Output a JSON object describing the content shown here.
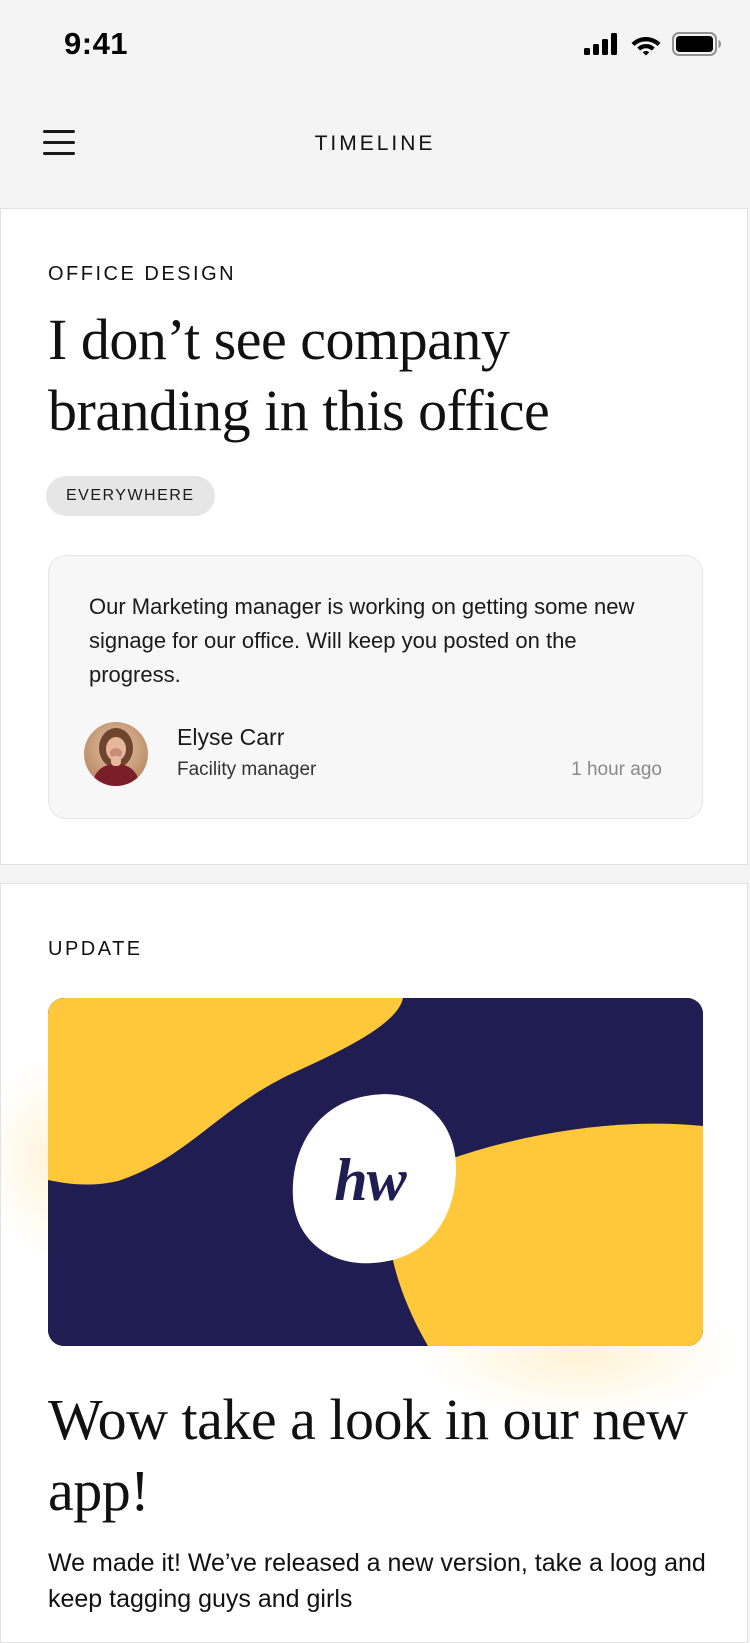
{
  "status_bar": {
    "time": "9:41"
  },
  "nav": {
    "title": "TIMELINE"
  },
  "posts": [
    {
      "category": "OFFICE DESIGN",
      "title": "I don’t see company branding in this office",
      "tag": "EVERYWHERE",
      "comment": {
        "text": "Our Marketing manager is working on getting some new signage for our office. Will keep you posted on the progress.",
        "author_name": "Elyse Carr",
        "author_role": "Facility manager",
        "time": "1 hour ago"
      }
    },
    {
      "category": "UPDATE",
      "banner_logo": "hw",
      "title": "Wow take a look in our new app!",
      "body": "We made it! We’ve released a new version, take a loog and keep tagging guys and girls"
    }
  ],
  "colors": {
    "navy": "#1f1d52",
    "yellow": "#ffc73a",
    "card_bg": "#ffffff",
    "page_bg": "#f4f4f4",
    "tag_bg": "#e6e6e6"
  }
}
